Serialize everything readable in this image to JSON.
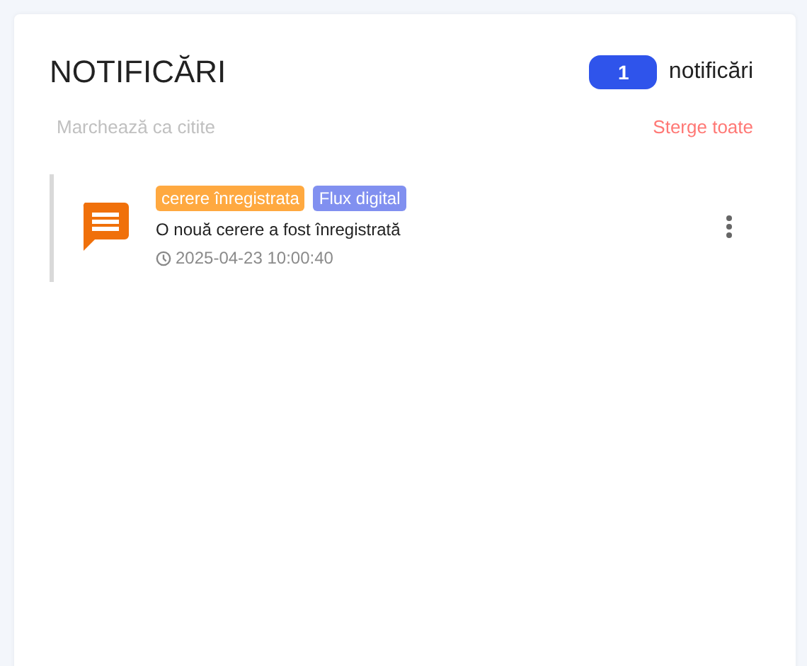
{
  "header": {
    "title": "NOTIFICĂRI",
    "count": "1",
    "count_label": "notificări"
  },
  "actions": {
    "mark_read": {
      "label": "Marchează ca citite",
      "disabled": true
    },
    "delete_all": {
      "label": "Sterge toate"
    }
  },
  "notifications": [
    {
      "tags": [
        {
          "label": "cerere înregistrata",
          "color": "#ffa940"
        },
        {
          "label": "Flux digital",
          "color": "#8190f0"
        }
      ],
      "message": "O nouă cerere a fost înregistrată",
      "time": "2025-04-23 10:00:40",
      "read": false
    }
  ]
}
